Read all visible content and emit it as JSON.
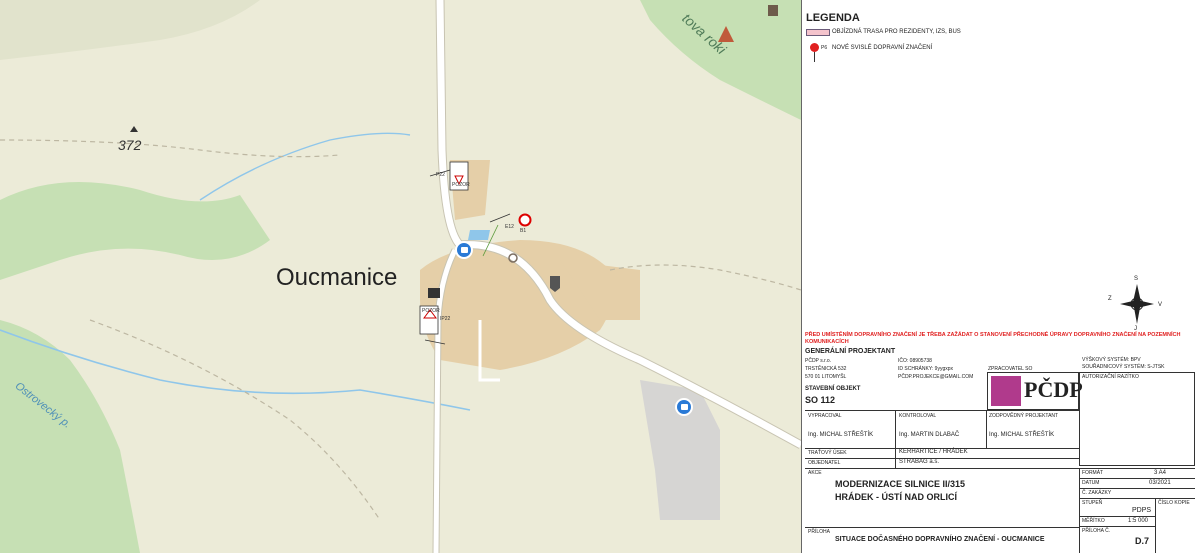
{
  "map": {
    "village_label": "Oucmanice",
    "elevation_label": "372",
    "stream_label": "Ostrovecký p.",
    "ridge_label": "tova roki",
    "sign_labels": [
      "POZOR",
      "P22",
      "P22",
      "B1",
      "E12",
      "IP22"
    ],
    "colors": {
      "base": "#ecebd8",
      "forest": "#c6e0b4",
      "built": "#e5cfa8",
      "road": "#ffffff",
      "water": "#8fc6ea",
      "bus": "#2a7ad6"
    }
  },
  "legend": {
    "title": "LEGENDA",
    "items": [
      {
        "icon": "detour-route-line-icon",
        "label": "OBJÍZDNÁ TRASA PRO REZIDENTY, IZS, BUS"
      },
      {
        "icon": "new-sign-icon",
        "label": "NOVÉ SVISLÉ DOPRAVNÍ ZNAČENÍ"
      }
    ],
    "sign_sample_code": "P6"
  },
  "compass": {
    "labels": [
      "S",
      "V",
      "J",
      "Z"
    ]
  },
  "note": "PŘED UMÍSTĚNÍM DOPRAVNÍHO ZNAČENÍ JE TŘEBA ZAŽÁDAT O STANOVENÍ PŘECHODNÉ ÚPRAVY DOPRAVNÍHO ZNAČENÍ NA POZEMNÍCH KOMUNIKACÍCH",
  "title_block": {
    "general_designer_label": "GENERÁLNÍ PROJEKTANT",
    "company": [
      "PČDP s.r.o.",
      "TRSTĚNICKÁ 532",
      "570 01 LITOMYŠL"
    ],
    "ids": [
      "IČO: 08905738",
      "ID SCHRÁNKY: 9yygxpx",
      "PČDP.PROJEKCE@GMAIL.COM"
    ],
    "zpracovatel_label": "ZPRACOVATEL SO",
    "systems": [
      "VÝŠKOVÝ SYSTÉM: BPV",
      "SOUŘADNICOVÝ SYSTÉM: S-JTSK"
    ],
    "stamp_label": "AUTORIZAČNÍ RAZÍTKO",
    "logo_text": "PČDP",
    "so_label": "STAVEBNÍ OBJEKT",
    "so_value": "SO 112",
    "vypracoval_label": "VYPRACOVAL",
    "vypracoval": "Ing. MICHAL STŘEŠTÍK",
    "kontroloval_label": "KONTROLOVAL",
    "kontroloval": "Ing. MARTIN DLABAČ",
    "zodpovedny_label": "ZODPOVĚDNÝ PROJEKTANT",
    "zodpovedny": "Ing. MICHAL STŘEŠTÍK",
    "tratovy_label": "TRAŤOVÝ ÚSEK",
    "tratovy": "KERHARTICE / HRÁDEK",
    "objednatel_label": "OBJEDNATEL",
    "objednatel": "STRABAG a.s.",
    "akce_label": "AKCE",
    "akce_1": "MODERNIZACE SILNICE II/315",
    "akce_2": "HRÁDEK - ÚSTÍ NAD ORLICÍ",
    "priloha_label": "PŘÍLOHA",
    "priloha": "SITUACE DOČASNÉHO DOPRAVNÍHO ZNAČENÍ - OUCMANICE",
    "format_label": "FORMÁT",
    "format": "3 A4",
    "datum_label": "DATUM",
    "datum": "03/2021",
    "zakazky_label": "Č. ZAKÁZKY",
    "zakazky": "",
    "stupen_label": "STUPEŇ",
    "stupen": "PDPS",
    "cislo_kopie_label": "ČÍSLO KOPIE",
    "cislo_kopie": "",
    "meritko_label": "MĚŘÍTKO",
    "meritko": "1:5 000",
    "priloha_c_label": "PŘÍLOHA Č.",
    "priloha_c": "D.7"
  }
}
